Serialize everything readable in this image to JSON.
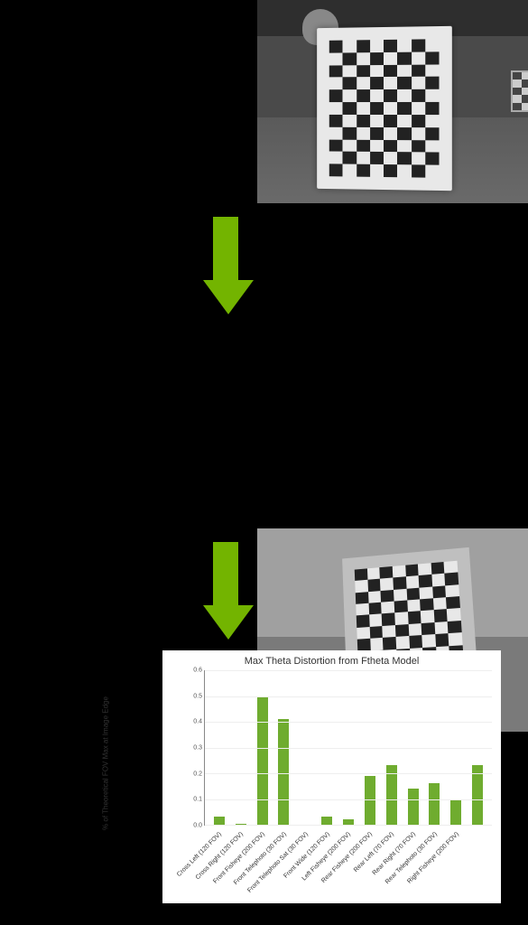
{
  "chart_data": {
    "type": "bar",
    "title": "Max Theta Distortion from Ftheta Model",
    "ylabel": "% of Theoretical FOV Max at Image Edge",
    "xlabel": "",
    "ylim": [
      0,
      0.6
    ],
    "yticks": [
      0,
      0.1,
      0.2,
      0.3,
      0.4,
      0.5,
      0.6
    ],
    "categories": [
      "Cross Left (120 FOV)",
      "Cross Right (120 FOV)",
      "Front Fisheye (200 FOV)",
      "Front Telephoto (30 FOV)",
      "Front Telephoto Sat (30 FOV)",
      "Front Wide (120 FOV)",
      "Left Fisheye (200 FOV)",
      "Rear Fisheye (200 FOV)",
      "Rear Left (70 FOV)",
      "Rear Right (70 FOV)",
      "Rear Telephoto (30 FOV)",
      "Right Fisheye (200 FOV)"
    ],
    "values": [
      0.03,
      0.005,
      0.5,
      0.41,
      0.0,
      0.03,
      0.02,
      0.19,
      0.23,
      0.14,
      0.16,
      0.1,
      0.23
    ]
  },
  "colors": {
    "arrow": "#73b400",
    "bar": "#6fac2f"
  }
}
